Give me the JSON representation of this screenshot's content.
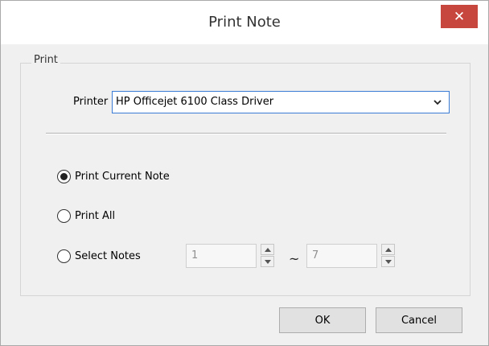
{
  "window": {
    "title": "Print Note",
    "close_glyph": "✕"
  },
  "print_group": {
    "legend": "Print",
    "printer_label": "Printer",
    "printer_value": "HP Officejet 6100 Class Driver"
  },
  "options": {
    "print_current": {
      "label": "Print Current Note",
      "selected": true
    },
    "print_all": {
      "label": "Print All",
      "selected": false
    },
    "select_notes": {
      "label": "Select Notes",
      "selected": false,
      "from_value": "1",
      "range_separator": "~",
      "to_value": "7"
    }
  },
  "buttons": {
    "ok_label": "OK",
    "cancel_label": "Cancel"
  },
  "colors": {
    "close_button": "#c7473f",
    "focus_border": "#3a7bd5"
  }
}
